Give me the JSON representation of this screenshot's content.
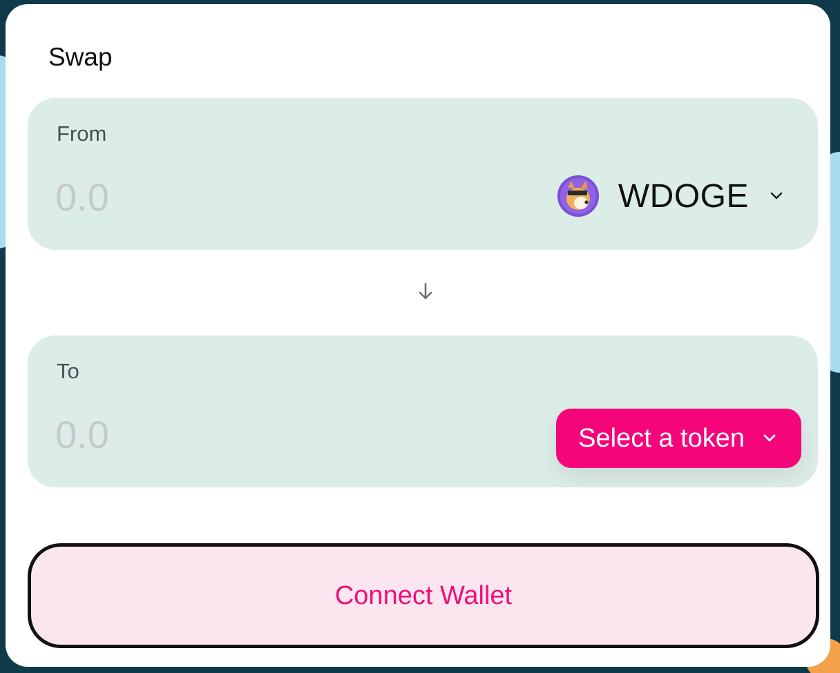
{
  "swap": {
    "title": "Swap",
    "from": {
      "label": "From",
      "amount_placeholder": "0.0",
      "amount_value": "",
      "token_symbol": "WDOGE",
      "token_icon": "wdoge-token-icon"
    },
    "switch_icon": "arrow-down-icon",
    "to": {
      "label": "To",
      "amount_placeholder": "0.0",
      "amount_value": "",
      "select_token_label": "Select a token"
    },
    "connect_wallet_label": "Connect Wallet"
  },
  "colors": {
    "panel_bg": "#dcece6",
    "accent_pink": "#f5057a",
    "connect_bg": "#fbe6ef",
    "connect_text": "#ee0f78"
  }
}
